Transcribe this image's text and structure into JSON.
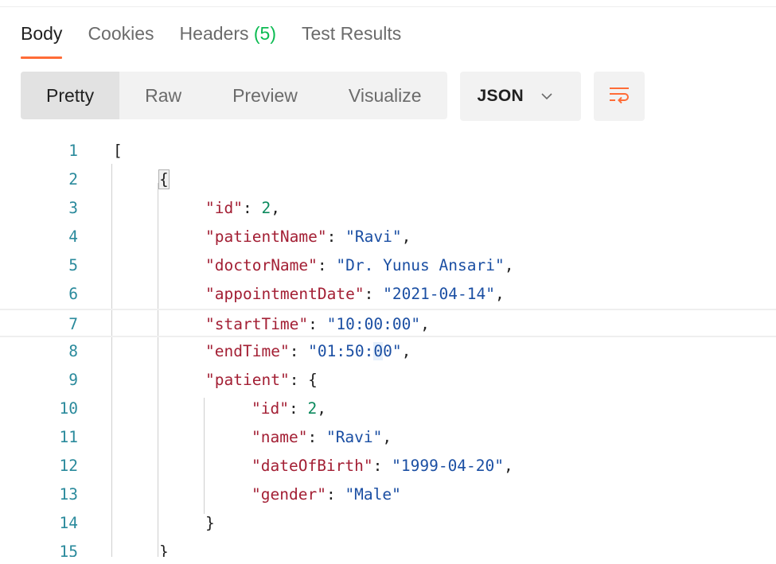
{
  "tabs": [
    {
      "label": "Body",
      "active": true
    },
    {
      "label": "Cookies",
      "active": false
    },
    {
      "label": "Headers",
      "count": "(5)",
      "active": false
    },
    {
      "label": "Test Results",
      "active": false
    }
  ],
  "toolbar": {
    "views": [
      {
        "label": "Pretty",
        "active": true
      },
      {
        "label": "Raw",
        "active": false
      },
      {
        "label": "Preview",
        "active": false
      },
      {
        "label": "Visualize",
        "active": false
      }
    ],
    "format": "JSON",
    "format_icon": "chevron-down-icon",
    "wrap_icon": "wrap-lines-icon"
  },
  "colors": {
    "accent": "#ff6c37",
    "count": "#0cbb52",
    "key": "#a31f34",
    "string": "#1b4fa3",
    "number": "#0c8a5e",
    "line_number": "#2a8a9c"
  },
  "code_lines": [
    {
      "n": "1",
      "text": "["
    },
    {
      "n": "2",
      "text": "{"
    },
    {
      "n": "3",
      "text": "\"id\": 2,"
    },
    {
      "n": "4",
      "text": "\"patientName\": \"Ravi\","
    },
    {
      "n": "5",
      "text": "\"doctorName\": \"Dr. Yunus Ansari\","
    },
    {
      "n": "6",
      "text": "\"appointmentDate\": \"2021-04-14\","
    },
    {
      "n": "7",
      "text": "\"startTime\": \"10:00:00\","
    },
    {
      "n": "8",
      "text": "\"endTime\": \"01:50:00\","
    },
    {
      "n": "9",
      "text": "\"patient\": {"
    },
    {
      "n": "10",
      "text": "\"id\": 2,"
    },
    {
      "n": "11",
      "text": "\"name\": \"Ravi\","
    },
    {
      "n": "12",
      "text": "\"dateOfBirth\": \"1999-04-20\","
    },
    {
      "n": "13",
      "text": "\"gender\": \"Male\""
    },
    {
      "n": "14",
      "text": "}"
    },
    {
      "n": "15",
      "text": "}"
    }
  ]
}
